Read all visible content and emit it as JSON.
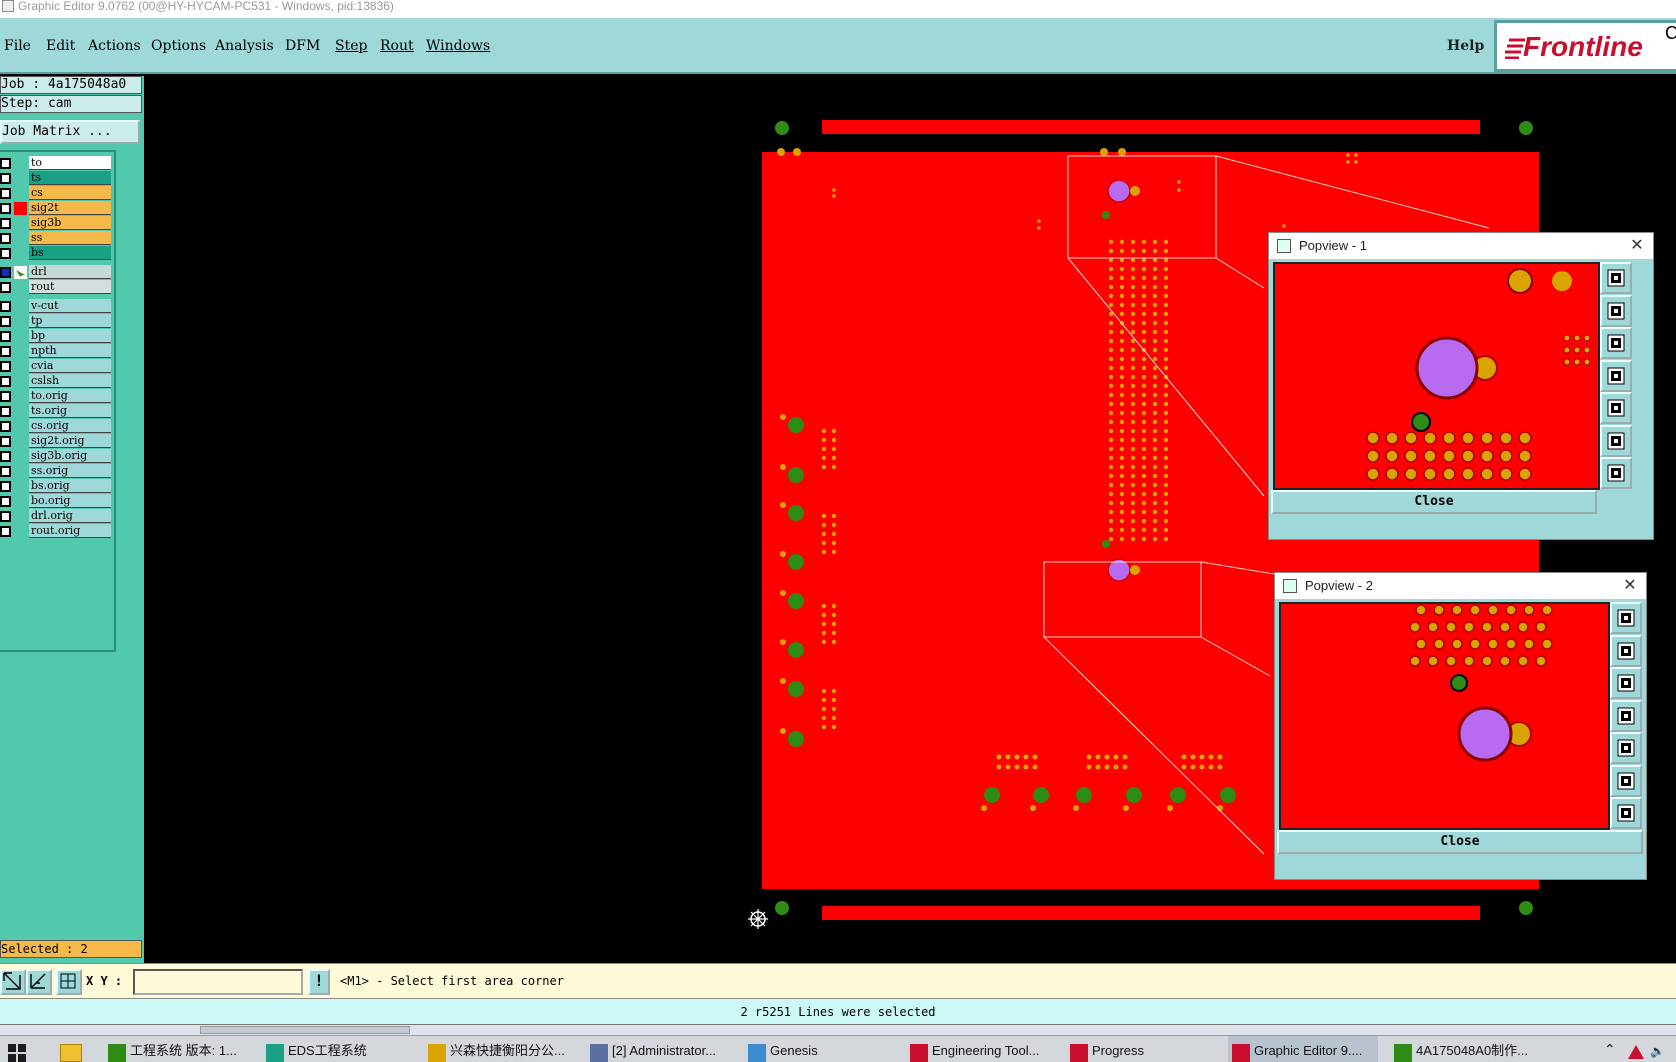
{
  "window": {
    "title": "Graphic Editor 9.0762 (00@HY-HYCAM-PC531 - Windows, pid:13836)"
  },
  "menu": {
    "items": [
      "File",
      "Edit",
      "Actions",
      "Options",
      "Analysis",
      "DFM",
      "Step",
      "Rout",
      "Windows"
    ],
    "help": "Help",
    "logo": "Frontline",
    "logo_cut": "C"
  },
  "job": {
    "label": "Job : 4a175048a0",
    "step": "Step: cam",
    "matrix_button": "Job Matrix ..."
  },
  "layers": [
    {
      "name": "to",
      "color": "#ffffff"
    },
    {
      "name": "ts",
      "color": "#1aa085"
    },
    {
      "name": "cs",
      "color": "#f5b84a"
    },
    {
      "name": "sig2t",
      "color": "#f5b84a"
    },
    {
      "name": "sig3b",
      "color": "#f5b84a"
    },
    {
      "name": "ss",
      "color": "#f5b84a"
    },
    {
      "name": "bs",
      "color": "#1aa085"
    },
    {
      "name": "drl",
      "color": "#c6d8d8"
    },
    {
      "name": "rout",
      "color": "#d4dede"
    },
    {
      "name": "v-cut",
      "color": "#9fd8d9"
    },
    {
      "name": "tp",
      "color": "#9fd8d9"
    },
    {
      "name": "bp",
      "color": "#9fd8d9"
    },
    {
      "name": "npth",
      "color": "#9fd8d9"
    },
    {
      "name": "cvia",
      "color": "#9fd8d9"
    },
    {
      "name": "cslsh",
      "color": "#9fd8d9"
    },
    {
      "name": "to.orig",
      "color": "#9fd8d9"
    },
    {
      "name": "ts.orig",
      "color": "#9fd8d9"
    },
    {
      "name": "cs.orig",
      "color": "#9fd8d9"
    },
    {
      "name": "sig2t.orig",
      "color": "#9fd8d9"
    },
    {
      "name": "sig3b.orig",
      "color": "#9fd8d9"
    },
    {
      "name": "ss.orig",
      "color": "#9fd8d9"
    },
    {
      "name": "bs.orig",
      "color": "#9fd8d9"
    },
    {
      "name": "bo.orig",
      "color": "#9fd8d9"
    },
    {
      "name": "drl.orig",
      "color": "#9fd8d9"
    },
    {
      "name": "rout.orig",
      "color": "#9fd8d9"
    }
  ],
  "selected": "Selected : 2",
  "popviews": [
    {
      "title": "Popview - 1",
      "close": "Close"
    },
    {
      "title": "Popview - 2",
      "close": "Close"
    }
  ],
  "cmd": {
    "xy_label": "X Y :",
    "xy_value": "",
    "prompt": "<M1> - Select first area corner",
    "alert_icon": "!"
  },
  "status": "2 r5251 Lines were selected",
  "taskbar": [
    {
      "label": "工程系统  版本: 1..."
    },
    {
      "label": "EDS工程系统"
    },
    {
      "label": "兴森快捷衡阳分公..."
    },
    {
      "label": "[2] Administrator..."
    },
    {
      "label": "Genesis"
    },
    {
      "label": "Engineering Tool..."
    },
    {
      "label": "Progress"
    },
    {
      "label": "Graphic Editor 9...."
    },
    {
      "label": "4A175048A0制作..."
    }
  ],
  "colors": {
    "board": "#ff0000",
    "pad": "#d9a300",
    "via": "#2e8b14",
    "big_pad": "#b86bf0",
    "panel": "#9fd8d9",
    "side": "#52c9ad"
  }
}
